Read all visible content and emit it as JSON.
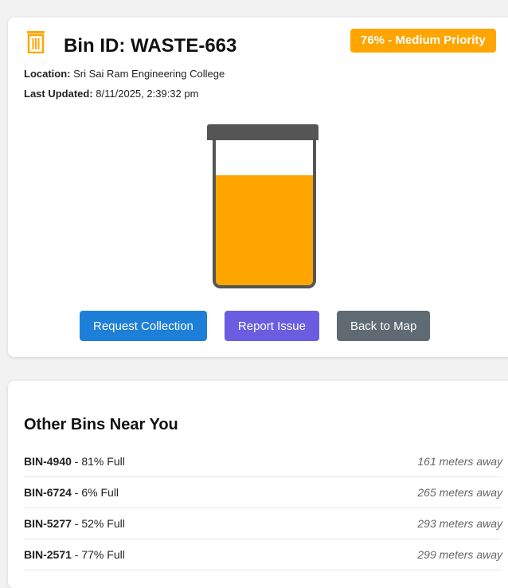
{
  "bin": {
    "id_label": "Bin ID: WASTE-663",
    "priority_badge": "76% - Medium Priority",
    "fill_fraction": 0.76,
    "location_label": "Location:",
    "location_value": "Sri Sai Ram Engineering College",
    "updated_label": "Last Updated:",
    "updated_value": "8/11/2025, 2:39:32 pm"
  },
  "actions": {
    "request_label": "Request Collection",
    "report_label": "Report Issue",
    "back_label": "Back to Map"
  },
  "nearby": {
    "title": "Other Bins Near You",
    "items": [
      {
        "id": "BIN-4940",
        "status": " - 81% Full",
        "distance": "161 meters away"
      },
      {
        "id": "BIN-6724",
        "status": " - 6% Full",
        "distance": "265 meters away"
      },
      {
        "id": "BIN-5277",
        "status": " - 52% Full",
        "distance": "293 meters away"
      },
      {
        "id": "BIN-2571",
        "status": " - 77% Full",
        "distance": "299 meters away"
      }
    ]
  },
  "colors": {
    "accent_orange": "#ffa500",
    "bin_outline": "#555555",
    "request_blue": "#1e7fd8",
    "report_purple": "#6a5de0",
    "back_gray": "#5f6a72"
  },
  "icons": {
    "header_icon": "trash-icon"
  }
}
